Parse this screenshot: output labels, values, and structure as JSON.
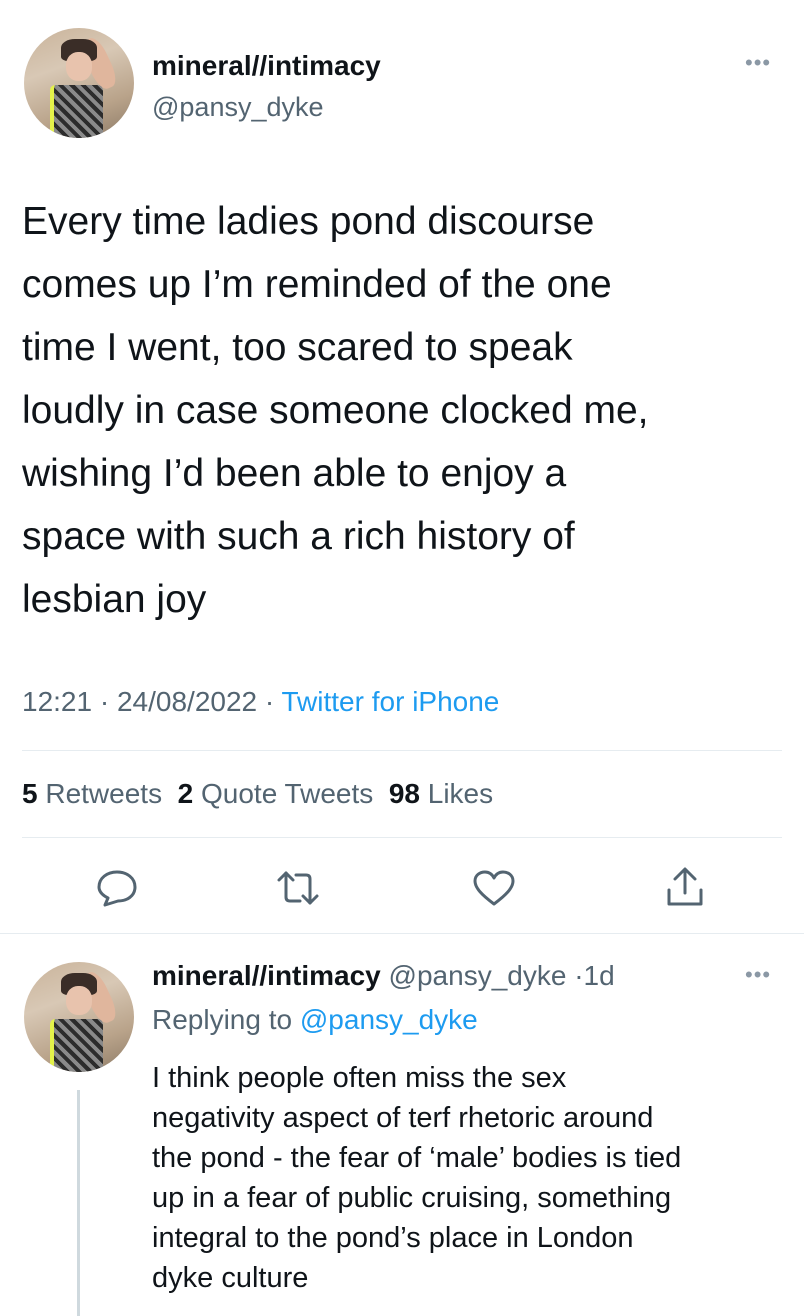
{
  "tweet": {
    "author_name": "mineral//intimacy",
    "author_handle": "@pansy_dyke",
    "more_icon": "more-dots-icon",
    "text": "Every time ladies pond discourse\ncomes up I’m reminded of the one\ntime I went, too scared to speak\nloudly in case someone clocked me,\nwishing I’d been able to enjoy a\nspace with such a rich history of\nlesbian joy",
    "time": "12:21",
    "date": "24/08/2022",
    "source": "Twitter for iPhone",
    "separator": "·",
    "stats": {
      "retweets_count": "5",
      "retweets_label": "Retweets",
      "quotes_count": "2",
      "quotes_label": "Quote Tweets",
      "likes_count": "98",
      "likes_label": "Likes"
    },
    "actions": [
      "reply-icon",
      "retweet-icon",
      "like-icon",
      "share-icon"
    ]
  },
  "reply": {
    "author_name": "mineral//intimacy",
    "author_handle": "@pansy_dyke",
    "separator": "·",
    "age": "1d",
    "replying_prefix": "Replying to",
    "replying_to": "@pansy_dyke",
    "text": "I think people often miss the sex\nnegativity aspect of terf rhetoric around\nthe pond - the fear of ‘male’ bodies is tied\nup in a fear of public cruising, something\nintegral to the pond’s place in London\ndyke culture"
  },
  "colors": {
    "accent": "#1d9bf0",
    "text": "#0f1419",
    "muted": "#536471",
    "divider": "#e6ecf0"
  }
}
